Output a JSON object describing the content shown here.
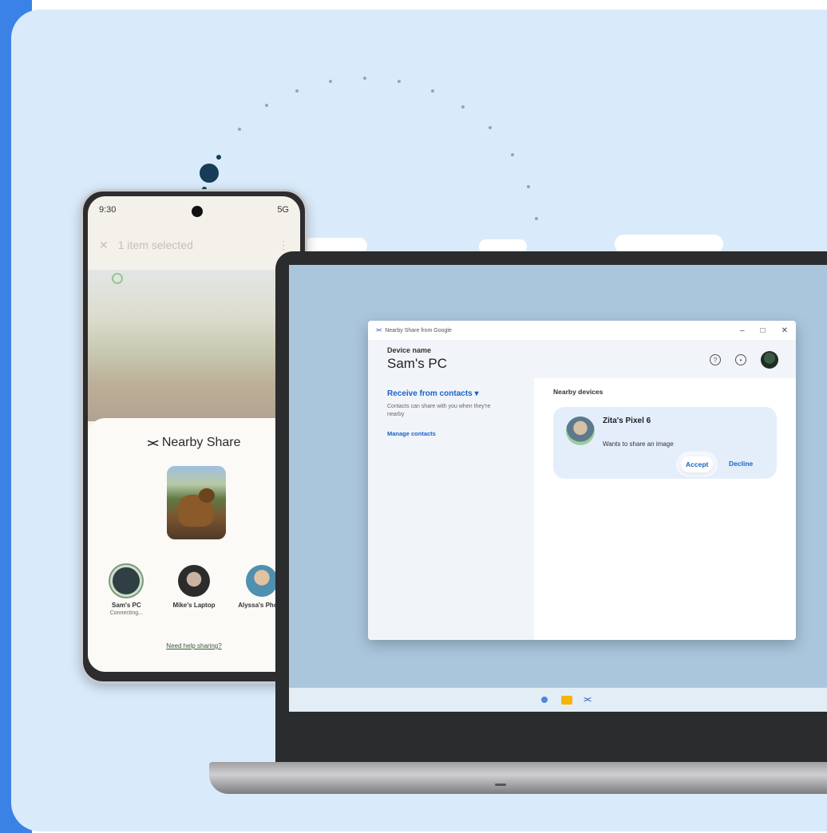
{
  "phone": {
    "status_time": "9:30",
    "status_signal": "5G",
    "appbar_title": "1 item selected",
    "share_title": "Nearby Share",
    "devices": [
      {
        "name": "Sam's PC",
        "sub": "Connecting..."
      },
      {
        "name": "Mike's Laptop",
        "sub": ""
      },
      {
        "name": "Alyssa's Phone",
        "sub": ""
      }
    ],
    "help_link": "Need help sharing?"
  },
  "window": {
    "title": "Nearby Share from Google",
    "device_label": "Device name",
    "device_value": "Sam's PC",
    "receive_label": "Receive from contacts",
    "receive_desc": "Contacts can share with you when they're nearby",
    "manage_contacts": "Manage contacts",
    "nearby_devices_label": "Nearby devices",
    "request": {
      "sender": "Zita's Pixel 6",
      "message": "Wants to share an image",
      "accept": "Accept",
      "decline": "Decline"
    },
    "controls": {
      "minimize": "–",
      "maximize": "□",
      "close": "✕"
    }
  },
  "icons": {
    "share": "nearby-share-icon",
    "help": "help-icon",
    "settings": "settings-icon",
    "chrome": "chrome-icon",
    "folder": "file-explorer-icon"
  },
  "colors": {
    "background_panel": "#d9ebfb",
    "accent_blue": "#1a63c9",
    "left_strip": "#3b82e6"
  }
}
